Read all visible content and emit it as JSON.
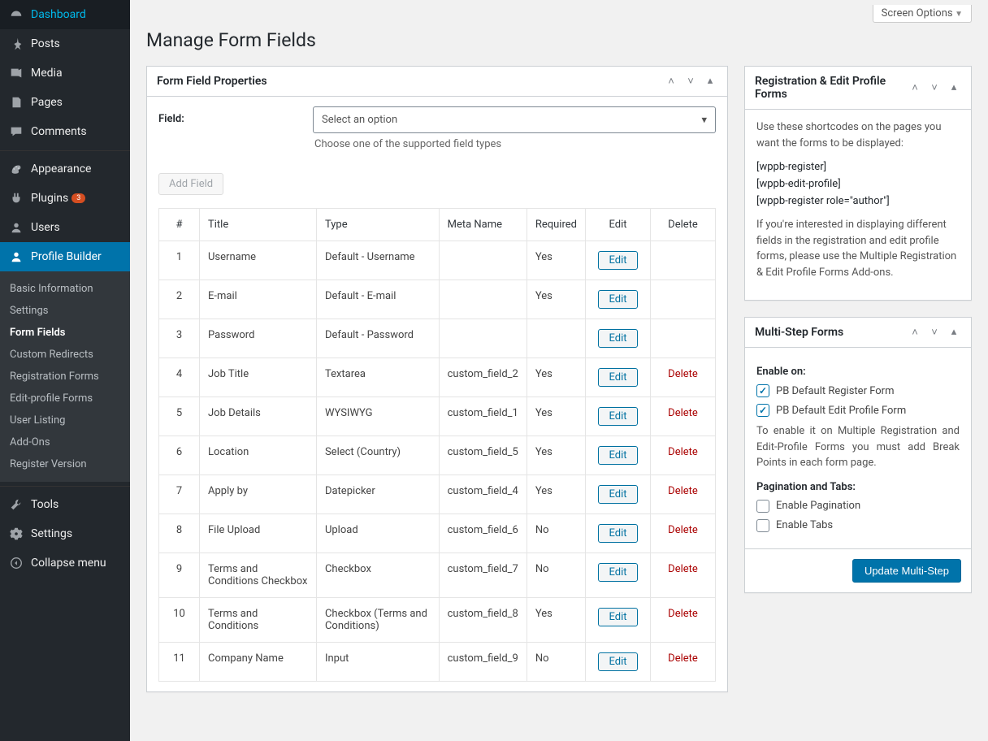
{
  "screen_options": "Screen Options",
  "page_title": "Manage Form Fields",
  "sidebar": {
    "items": [
      {
        "label": "Dashboard",
        "icon": "dashboard"
      },
      {
        "label": "Posts",
        "icon": "pin"
      },
      {
        "label": "Media",
        "icon": "media"
      },
      {
        "label": "Pages",
        "icon": "pages"
      },
      {
        "label": "Comments",
        "icon": "comments"
      },
      {
        "label": "Appearance",
        "icon": "appearance",
        "sep": true
      },
      {
        "label": "Plugins",
        "icon": "plugins",
        "badge": "3"
      },
      {
        "label": "Users",
        "icon": "users"
      },
      {
        "label": "Profile Builder",
        "icon": "profile",
        "active": true
      },
      {
        "label": "Tools",
        "icon": "tools",
        "sep": true
      },
      {
        "label": "Settings",
        "icon": "settings"
      },
      {
        "label": "Collapse menu",
        "icon": "collapse"
      }
    ],
    "submenu": [
      {
        "label": "Basic Information"
      },
      {
        "label": "Settings"
      },
      {
        "label": "Form Fields",
        "current": true
      },
      {
        "label": "Custom Redirects"
      },
      {
        "label": "Registration Forms"
      },
      {
        "label": "Edit-profile Forms"
      },
      {
        "label": "User Listing"
      },
      {
        "label": "Add-Ons"
      },
      {
        "label": "Register Version"
      }
    ]
  },
  "form_box": {
    "title": "Form Field Properties",
    "field_label": "Field:",
    "select_placeholder": "Select an option",
    "select_hint": "Choose one of the supported field types",
    "add_btn": "Add Field"
  },
  "table": {
    "headers": {
      "num": "#",
      "title": "Title",
      "type": "Type",
      "meta": "Meta Name",
      "required": "Required",
      "edit": "Edit",
      "delete": "Delete"
    },
    "edit_label": "Edit",
    "delete_label": "Delete",
    "rows": [
      {
        "n": "1",
        "title": "Username",
        "type": "Default - Username",
        "meta": "",
        "req": "Yes",
        "del": false
      },
      {
        "n": "2",
        "title": "E-mail",
        "type": "Default - E-mail",
        "meta": "",
        "req": "Yes",
        "del": false
      },
      {
        "n": "3",
        "title": "Password",
        "type": "Default - Password",
        "meta": "",
        "req": "",
        "del": false
      },
      {
        "n": "4",
        "title": "Job Title",
        "type": "Textarea",
        "meta": "custom_field_2",
        "req": "Yes",
        "del": true
      },
      {
        "n": "5",
        "title": "Job Details",
        "type": "WYSIWYG",
        "meta": "custom_field_1",
        "req": "Yes",
        "del": true
      },
      {
        "n": "6",
        "title": "Location",
        "type": "Select (Country)",
        "meta": "custom_field_5",
        "req": "Yes",
        "del": true
      },
      {
        "n": "7",
        "title": "Apply by",
        "type": "Datepicker",
        "meta": "custom_field_4",
        "req": "Yes",
        "del": true
      },
      {
        "n": "8",
        "title": "File Upload",
        "type": "Upload",
        "meta": "custom_field_6",
        "req": "No",
        "del": true
      },
      {
        "n": "9",
        "title": "Terms and Conditions Checkbox",
        "type": "Checkbox",
        "meta": "custom_field_7",
        "req": "No",
        "del": true
      },
      {
        "n": "10",
        "title": "Terms and Conditions",
        "type": "Checkbox (Terms and Conditions)",
        "meta": "custom_field_8",
        "req": "Yes",
        "del": true
      },
      {
        "n": "11",
        "title": "Company Name",
        "type": "Input",
        "meta": "custom_field_9",
        "req": "No",
        "del": true
      }
    ]
  },
  "reg_box": {
    "title": "Registration & Edit Profile Forms",
    "intro": "Use these shortcodes on the pages you want the forms to be displayed:",
    "sc1": "[wppb-register]",
    "sc2": "[wppb-edit-profile]",
    "sc3": "[wppb-register role=\"author\"]",
    "outro": "If you're interested in displaying different fields in the registration and edit profile forms, please use the Multiple Registration & Edit Profile Forms Add-ons."
  },
  "ms_box": {
    "title": "Multi-Step Forms",
    "enable_on": "Enable on:",
    "chk1": "PB Default Register Form",
    "chk2": "PB Default Edit Profile Form",
    "note": "To enable it on Multiple Registration and Edit-Profile Forms you must add Break Points in each form page.",
    "pag_title": "Pagination and Tabs:",
    "chk3": "Enable Pagination",
    "chk4": "Enable Tabs",
    "btn": "Update Multi-Step"
  }
}
